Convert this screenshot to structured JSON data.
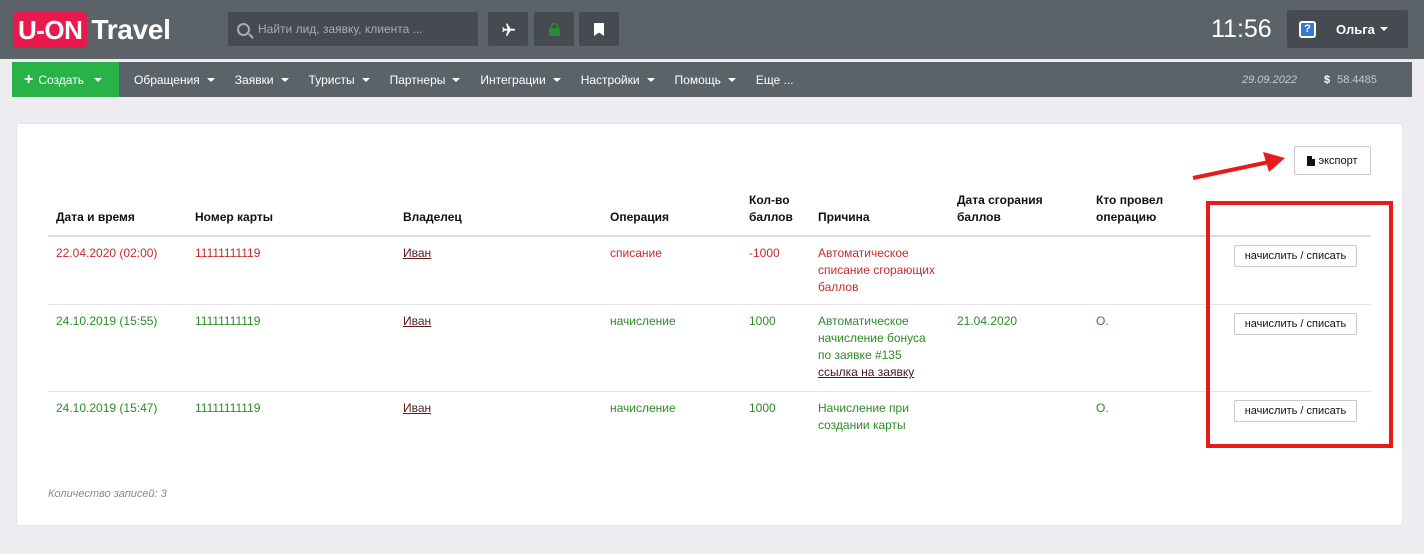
{
  "header": {
    "logo_brand": "U-ON",
    "logo_word": "Travel",
    "search_placeholder": "Найти лид, заявку, клиента ...",
    "clock": "11:56",
    "user_name": "Ольга"
  },
  "nav": {
    "create_label": "Создать",
    "items": [
      "Обращения",
      "Заявки",
      "Туристы",
      "Партнеры",
      "Интеграции",
      "Настройки",
      "Помощь",
      "Еще ..."
    ],
    "date": "29.09.2022",
    "currency_symbol": "$",
    "rate": "58.4485"
  },
  "export_label": "экспорт",
  "table": {
    "headers": {
      "datetime": "Дата и время",
      "card": "Номер карты",
      "owner": "Владелец",
      "operation": "Операция",
      "points_line1": "Кол-во",
      "points_line2": "баллов",
      "reason": "Причина",
      "expiry_line1": "Дата сгорания",
      "expiry_line2": "баллов",
      "who_line1": "Кто провел",
      "who_line2": "операцию"
    },
    "rows": [
      {
        "datetime": "22.04.2020 (02:00)",
        "card": "11111111119",
        "owner": "Иван",
        "operation": "списание",
        "points": "-1000",
        "reason_line1": "Автоматическое",
        "reason_line2": "списание сгорающих",
        "reason_line3": "баллов",
        "expiry": "",
        "who": "",
        "action": "начислить / списать"
      },
      {
        "datetime": "24.10.2019 (15:55)",
        "card": "11111111119",
        "owner": "Иван",
        "operation": "начисление",
        "points": "1000",
        "reason_line1": "Автоматическое",
        "reason_line2": "начисление бонуса",
        "reason_line3": "по заявке #135",
        "reason_link": "ссылка на заявку",
        "expiry": "21.04.2020",
        "who": "О.",
        "action": "начислить / списать"
      },
      {
        "datetime": "24.10.2019 (15:47)",
        "card": "11111111119",
        "owner": "Иван",
        "operation": "начисление",
        "points": "1000",
        "reason_line1": "Начисление при",
        "reason_line2": "создании карты",
        "expiry": "",
        "who": "О.",
        "action": "начислить / списать"
      }
    ]
  },
  "records_count": "Количество записей: 3"
}
